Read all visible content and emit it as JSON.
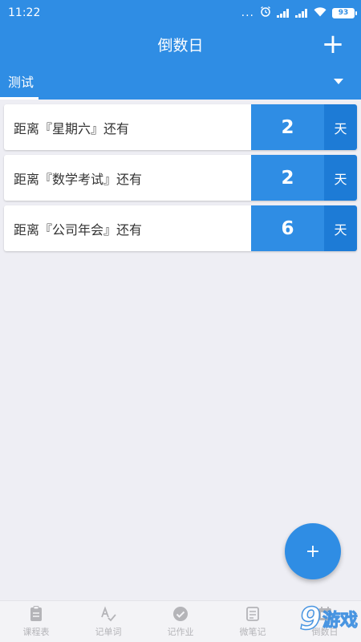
{
  "status_bar": {
    "time": "11:22",
    "dots": "...",
    "alarm_icon": "alarm-icon",
    "battery": "93"
  },
  "app_bar": {
    "title": "倒数日",
    "add_label": "+"
  },
  "tabs": [
    {
      "label": "测试"
    }
  ],
  "countdowns": [
    {
      "label": "距离『星期六』还有",
      "days": "2",
      "unit": "天"
    },
    {
      "label": "距离『数学考试』还有",
      "days": "2",
      "unit": "天"
    },
    {
      "label": "距离『公司年会』还有",
      "days": "6",
      "unit": "天"
    }
  ],
  "fab": {
    "label": "+"
  },
  "bottom_nav": [
    {
      "label": "课程表",
      "icon": "clipboard-icon"
    },
    {
      "label": "记单词",
      "icon": "spell-check-icon"
    },
    {
      "label": "记作业",
      "icon": "check-circle-icon"
    },
    {
      "label": "微笔记",
      "icon": "note-icon"
    },
    {
      "label": "倒数日",
      "icon": "calendar-icon"
    }
  ],
  "watermark": {
    "number": "9",
    "text": "游戏"
  },
  "colors": {
    "primary": "#2f8de4",
    "unit_bg": "#1d7bd6",
    "background": "#eeeef4",
    "nav_inactive": "#b4b4b8"
  }
}
